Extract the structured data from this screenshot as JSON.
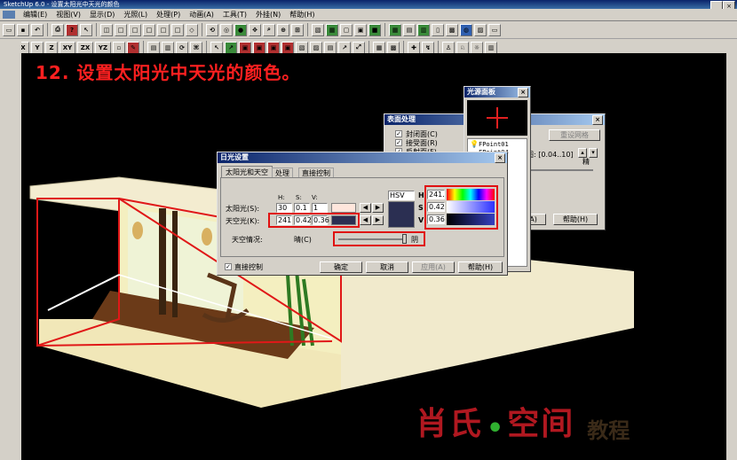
{
  "app": {
    "title": "SketchUp 6.0 - 设置太阳光中天光的颜色"
  },
  "menu": [
    "编辑(E)",
    "视图(V)",
    "显示(D)",
    "光照(L)",
    "处理(P)",
    "动画(A)",
    "工具(T)",
    "外挂(N)",
    "帮助(H)"
  ],
  "toolbar2": [
    "X",
    "Y",
    "Z",
    "XY",
    "ZX",
    "YZ"
  ],
  "heading": "12. 设置太阳光中天光的颜色。",
  "surface_dialog": {
    "title": "表面处理",
    "checks": [
      "封闭面(C)",
      "接受面(R)",
      "反射面(F)"
    ],
    "btn_default": "重设网格",
    "range_label": "图: [0.04..10]",
    "unit": "精",
    "btn_ok": "(A)",
    "btn_help": "帮助(H)"
  },
  "light_panel": {
    "title": "光源面板",
    "items": [
      "FPoint01",
      "FPoint04"
    ]
  },
  "sun_dialog": {
    "title": "日光设置",
    "tabs": [
      "太阳光和天空",
      "处理",
      "直接控制"
    ],
    "col_h": "H:",
    "col_s": "S:",
    "col_v": "V:",
    "sun_label": "太阳光(S):",
    "sun_values": [
      "30",
      "0.1",
      "1"
    ],
    "sky_label": "天空光(K):",
    "sky_values": [
      "241",
      "0.42",
      "0.36"
    ],
    "mode": "HSV",
    "h_label": "H",
    "s_label": "S",
    "v_label": "V",
    "h_value": "241.",
    "s_value": "0.42",
    "v_value": "0.36",
    "sky_status_label": "天空情况:",
    "sunny": "晴(C)",
    "cloudy": "阴",
    "direct_control": "直接控制",
    "btn_ok": "确定",
    "btn_cancel": "取消",
    "btn_apply": "应用(A)",
    "btn_help": "帮助(H)",
    "sky_color": "#2b2f52",
    "sun_color": "#ffe6dc"
  },
  "watermark": {
    "main": "肖氏",
    "dot": "•",
    "main2": "空间",
    "sub": "教程"
  }
}
